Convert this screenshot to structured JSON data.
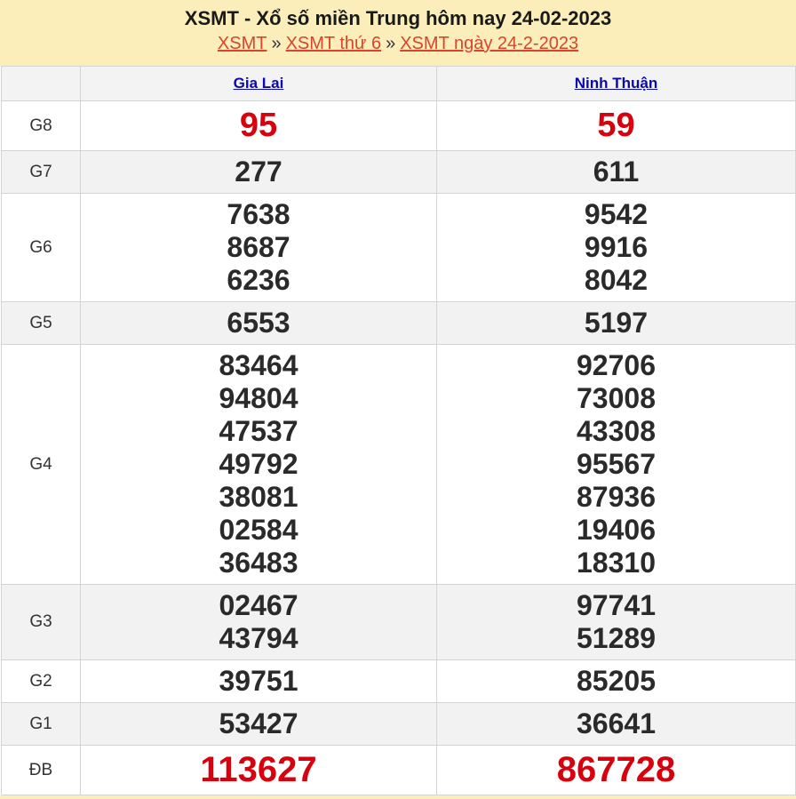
{
  "header": {
    "title": "XSMT - Xổ số miền Trung hôm nay 24-02-2023",
    "crumbs": [
      "XSMT",
      "XSMT thứ 6",
      "XSMT ngày 24-2-2023"
    ],
    "separator": "»"
  },
  "provinces": [
    "Gia Lai",
    "Ninh Thuận"
  ],
  "prizes": [
    {
      "label": "G8",
      "style": "red",
      "values": [
        [
          "95"
        ],
        [
          "59"
        ]
      ]
    },
    {
      "label": "G7",
      "style": "normal",
      "values": [
        [
          "277"
        ],
        [
          "611"
        ]
      ]
    },
    {
      "label": "G6",
      "style": "normal",
      "values": [
        [
          "7638",
          "8687",
          "6236"
        ],
        [
          "9542",
          "9916",
          "8042"
        ]
      ]
    },
    {
      "label": "G5",
      "style": "normal",
      "values": [
        [
          "6553"
        ],
        [
          "5197"
        ]
      ]
    },
    {
      "label": "G4",
      "style": "normal",
      "values": [
        [
          "83464",
          "94804",
          "47537",
          "49792",
          "38081",
          "02584",
          "36483"
        ],
        [
          "92706",
          "73008",
          "43308",
          "95567",
          "87936",
          "19406",
          "18310"
        ]
      ]
    },
    {
      "label": "G3",
      "style": "normal",
      "values": [
        [
          "02467",
          "43794"
        ],
        [
          "97741",
          "51289"
        ]
      ]
    },
    {
      "label": "G2",
      "style": "normal",
      "values": [
        [
          "39751"
        ],
        [
          "85205"
        ]
      ]
    },
    {
      "label": "G1",
      "style": "normal",
      "values": [
        [
          "53427"
        ],
        [
          "36641"
        ]
      ]
    },
    {
      "label": "ĐB",
      "style": "big",
      "values": [
        [
          "113627"
        ],
        [
          "867728"
        ]
      ]
    }
  ],
  "colors": {
    "header_bg": "#fbeebb",
    "link": "#d9452a",
    "province": "#0a0aa8",
    "highlight": "#d8000c",
    "alt_row": "#f2f2f2"
  }
}
